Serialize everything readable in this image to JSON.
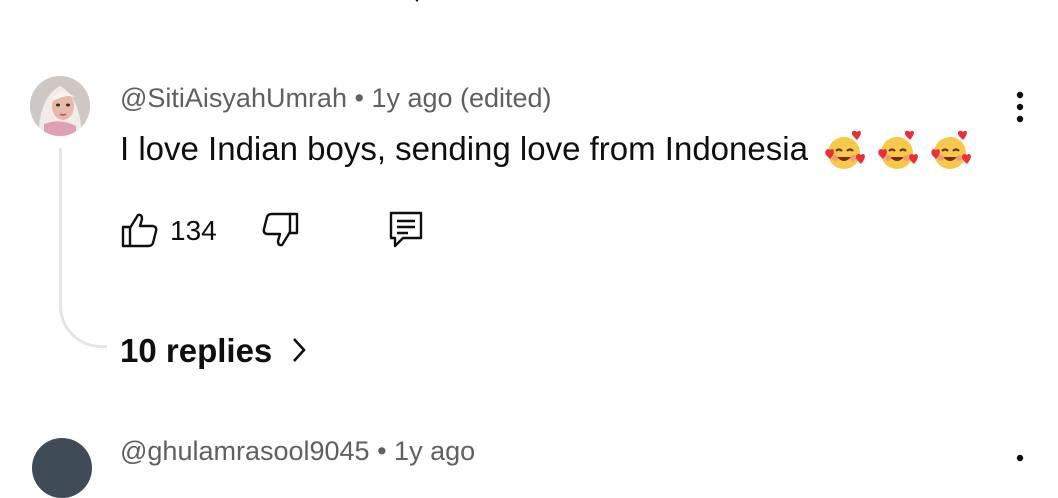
{
  "comment": {
    "username": "@SitiAisyahUmrah",
    "separator": " • ",
    "age": "1y ago (edited)",
    "text": "I love Indian boys, sending love from Indonesia",
    "emoji_icon": "smiling-face-with-hearts-icon",
    "emoji_count": 3,
    "likes": "134",
    "replies_label": "10 replies"
  },
  "next_comment": {
    "username": "@ghulamrasool9045",
    "separator": " • ",
    "age": "1y ago"
  },
  "colors": {
    "text": "#0f0f0f",
    "meta": "#606060",
    "thread_line": "#e5e5e5"
  }
}
